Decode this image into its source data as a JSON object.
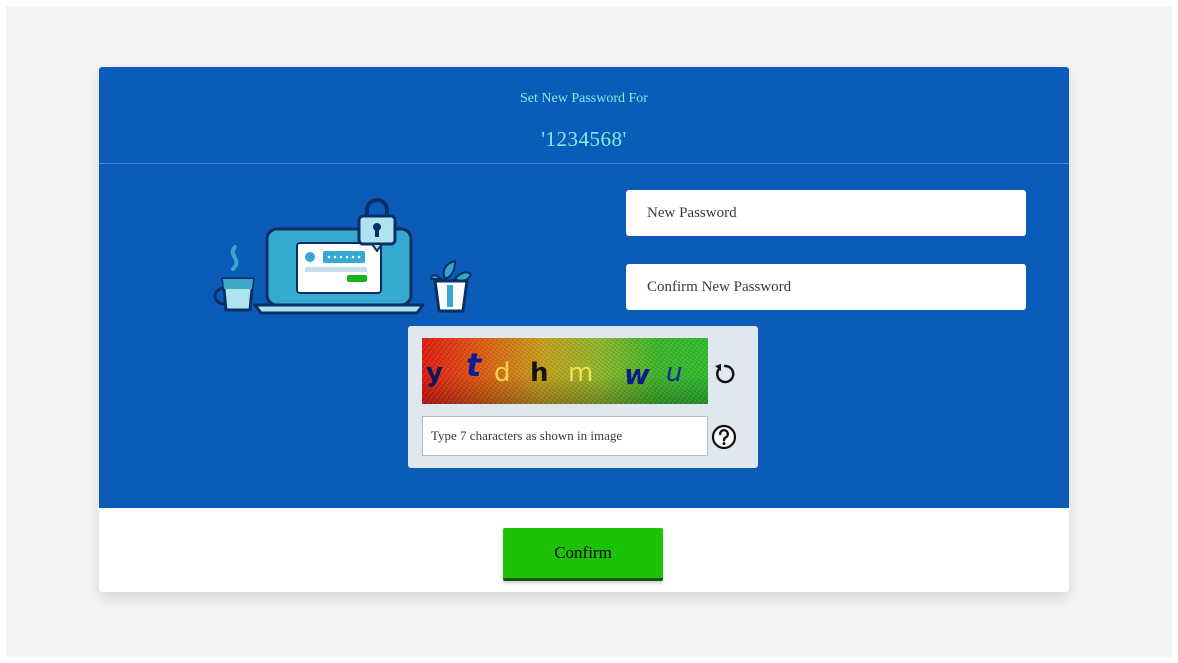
{
  "header": {
    "title": "Set New Password For",
    "username": "'1234568'"
  },
  "form": {
    "new_password_placeholder": "New Password",
    "confirm_password_placeholder": "Confirm New Password"
  },
  "captcha": {
    "image_text": [
      "y",
      "t",
      "d",
      "h",
      "m",
      "w",
      "u"
    ],
    "input_placeholder": "Type 7 characters as shown in image",
    "refresh_icon": "refresh-icon",
    "help_icon": "question-circle-icon"
  },
  "actions": {
    "confirm_label": "Confirm"
  },
  "colors": {
    "panel_blue": "#0b5cb8",
    "header_text": "#7ff0e6",
    "confirm_green": "#1bc208"
  }
}
